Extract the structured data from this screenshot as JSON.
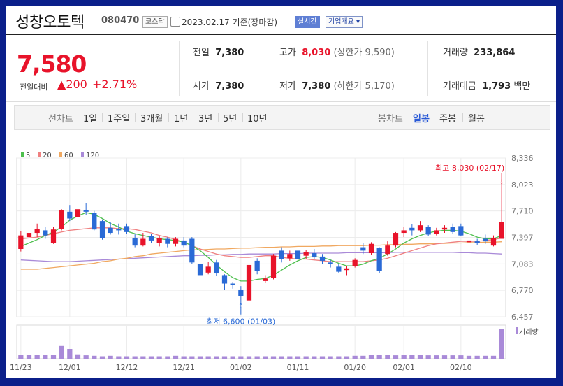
{
  "header": {
    "name": "성창오토텍",
    "code": "080470",
    "market": "코스닥",
    "date": "2023.02.17",
    "basis": "기준(장마감)",
    "realtime": "실시간",
    "company_info": "기업개요"
  },
  "summary": {
    "price": "7,580",
    "change_label": "전일대비",
    "change": "200",
    "change_pct": "+2.71%",
    "prev_label": "전일",
    "prev": "7,380",
    "high_label": "고가",
    "high": "8,030",
    "upper_limit_label": "(상한가",
    "upper_limit": "9,590",
    "upper_close": ")",
    "volume_label": "거래량",
    "volume": "233,864",
    "open_label": "시가",
    "open": "7,380",
    "low_label": "저가",
    "low": "7,380",
    "lower_limit_label": "(하한가",
    "lower_limit": "5,170",
    "lower_close": ")",
    "amount_label": "거래대금",
    "amount": "1,793",
    "amount_unit": "백만"
  },
  "periods": {
    "line_label": "선차트",
    "items": [
      "1일",
      "1주일",
      "3개월",
      "1년",
      "3년",
      "5년",
      "10년"
    ],
    "candle_label": "봉차트",
    "candle_items": [
      "일봉",
      "주봉",
      "월봉"
    ],
    "selected_candle": "일봉"
  },
  "colors": {
    "up": "#e8132a",
    "down": "#2a6ad6",
    "ma5": "#4cbf4c",
    "ma20": "#ef8080",
    "ma60": "#f0a860",
    "ma120": "#a98ad8",
    "volume": "#a98ad8"
  },
  "chart_data": {
    "type": "candlestick",
    "legend": [
      {
        "name": "5",
        "color": "#4cbf4c"
      },
      {
        "name": "20",
        "color": "#ef8080"
      },
      {
        "name": "60",
        "color": "#f0a860"
      },
      {
        "name": "120",
        "color": "#a98ad8"
      }
    ],
    "y_ticks": [
      8336,
      8023,
      7710,
      7397,
      7083,
      6770,
      6457
    ],
    "y_tick_labels": [
      "8,336",
      "8,023",
      "7,710",
      "7,397",
      "7,083",
      "6,770",
      "6,457"
    ],
    "ylim": [
      6457,
      8336
    ],
    "x_labels": [
      {
        "label": "11/23",
        "index": 0
      },
      {
        "label": "12/01",
        "index": 6
      },
      {
        "label": "12/12",
        "index": 13
      },
      {
        "label": "12/21",
        "index": 20
      },
      {
        "label": "01/02",
        "index": 27
      },
      {
        "label": "01/11",
        "index": 34
      },
      {
        "label": "01/20",
        "index": 41
      },
      {
        "label": "02/01",
        "index": 47
      },
      {
        "label": "02/10",
        "index": 54
      }
    ],
    "candles": [
      {
        "o": 7260,
        "c": 7420,
        "h": 7470,
        "l": 7230
      },
      {
        "o": 7400,
        "c": 7450,
        "h": 7490,
        "l": 7330
      },
      {
        "o": 7450,
        "c": 7500,
        "h": 7560,
        "l": 7400
      },
      {
        "o": 7480,
        "c": 7420,
        "h": 7520,
        "l": 7380
      },
      {
        "o": 7330,
        "c": 7490,
        "h": 7520,
        "l": 7320
      },
      {
        "o": 7500,
        "c": 7720,
        "h": 7730,
        "l": 7480
      },
      {
        "o": 7700,
        "c": 7620,
        "h": 7780,
        "l": 7590
      },
      {
        "o": 7640,
        "c": 7730,
        "h": 7800,
        "l": 7620
      },
      {
        "o": 7720,
        "c": 7700,
        "h": 7800,
        "l": 7660
      },
      {
        "o": 7690,
        "c": 7490,
        "h": 7710,
        "l": 7480
      },
      {
        "o": 7590,
        "c": 7390,
        "h": 7610,
        "l": 7370
      },
      {
        "o": 7510,
        "c": 7450,
        "h": 7580,
        "l": 7430
      },
      {
        "o": 7500,
        "c": 7480,
        "h": 7560,
        "l": 7430
      },
      {
        "o": 7530,
        "c": 7460,
        "h": 7560,
        "l": 7440
      },
      {
        "o": 7390,
        "c": 7300,
        "h": 7440,
        "l": 7280
      },
      {
        "o": 7300,
        "c": 7380,
        "h": 7450,
        "l": 7290
      },
      {
        "o": 7410,
        "c": 7360,
        "h": 7440,
        "l": 7330
      },
      {
        "o": 7330,
        "c": 7390,
        "h": 7420,
        "l": 7290
      },
      {
        "o": 7380,
        "c": 7320,
        "h": 7400,
        "l": 7280
      },
      {
        "o": 7320,
        "c": 7380,
        "h": 7400,
        "l": 7290
      },
      {
        "o": 7360,
        "c": 7300,
        "h": 7400,
        "l": 7280
      },
      {
        "o": 7380,
        "c": 7100,
        "h": 7400,
        "l": 7080
      },
      {
        "o": 7080,
        "c": 6950,
        "h": 7100,
        "l": 6920
      },
      {
        "o": 6980,
        "c": 7050,
        "h": 7110,
        "l": 6960
      },
      {
        "o": 7100,
        "c": 6970,
        "h": 7130,
        "l": 6940
      },
      {
        "o": 6950,
        "c": 6850,
        "h": 6960,
        "l": 6780
      },
      {
        "o": 6850,
        "c": 6830,
        "h": 6870,
        "l": 6790
      },
      {
        "o": 6780,
        "c": 6700,
        "h": 6820,
        "l": 6600
      },
      {
        "o": 6650,
        "c": 7070,
        "h": 7080,
        "l": 6640
      },
      {
        "o": 7120,
        "c": 7000,
        "h": 7150,
        "l": 6960
      },
      {
        "o": 6880,
        "c": 6910,
        "h": 6950,
        "l": 6860
      },
      {
        "o": 6920,
        "c": 7180,
        "h": 7200,
        "l": 6900
      },
      {
        "o": 7240,
        "c": 7140,
        "h": 7280,
        "l": 7100
      },
      {
        "o": 7150,
        "c": 7200,
        "h": 7240,
        "l": 7120
      },
      {
        "o": 7240,
        "c": 7140,
        "h": 7270,
        "l": 7120
      },
      {
        "o": 7180,
        "c": 7220,
        "h": 7250,
        "l": 7140
      },
      {
        "o": 7210,
        "c": 7160,
        "h": 7260,
        "l": 7140
      },
      {
        "o": 7170,
        "c": 7120,
        "h": 7200,
        "l": 7080
      },
      {
        "o": 7100,
        "c": 7080,
        "h": 7130,
        "l": 7040
      },
      {
        "o": 7050,
        "c": 6990,
        "h": 7080,
        "l": 6980
      },
      {
        "o": 7010,
        "c": 7030,
        "h": 7060,
        "l": 6950
      },
      {
        "o": 7060,
        "c": 7130,
        "h": 7150,
        "l": 7040
      },
      {
        "o": 7280,
        "c": 7240,
        "h": 7330,
        "l": 7200
      },
      {
        "o": 7210,
        "c": 7320,
        "h": 7340,
        "l": 7190
      },
      {
        "o": 7270,
        "c": 7000,
        "h": 7280,
        "l": 6970
      },
      {
        "o": 7200,
        "c": 7300,
        "h": 7350,
        "l": 7180
      },
      {
        "o": 7300,
        "c": 7450,
        "h": 7460,
        "l": 7280
      },
      {
        "o": 7450,
        "c": 7480,
        "h": 7520,
        "l": 7400
      },
      {
        "o": 7510,
        "c": 7480,
        "h": 7550,
        "l": 7420
      },
      {
        "o": 7480,
        "c": 7540,
        "h": 7590,
        "l": 7460
      },
      {
        "o": 7520,
        "c": 7430,
        "h": 7540,
        "l": 7410
      },
      {
        "o": 7440,
        "c": 7480,
        "h": 7510,
        "l": 7420
      },
      {
        "o": 7490,
        "c": 7510,
        "h": 7540,
        "l": 7450
      },
      {
        "o": 7520,
        "c": 7460,
        "h": 7560,
        "l": 7440
      },
      {
        "o": 7530,
        "c": 7420,
        "h": 7560,
        "l": 7410
      },
      {
        "o": 7340,
        "c": 7360,
        "h": 7380,
        "l": 7310
      },
      {
        "o": 7350,
        "c": 7330,
        "h": 7380,
        "l": 7310
      },
      {
        "o": 7380,
        "c": 7350,
        "h": 7430,
        "l": 7320
      },
      {
        "o": 7300,
        "c": 7390,
        "h": 7420,
        "l": 7290
      },
      {
        "o": 7380,
        "c": 7580,
        "h": 8030,
        "l": 7380
      }
    ],
    "ma5": [
      7290,
      7330,
      7370,
      7420,
      7460,
      7520,
      7600,
      7650,
      7690,
      7670,
      7620,
      7560,
      7520,
      7470,
      7440,
      7420,
      7400,
      7380,
      7370,
      7360,
      7340,
      7300,
      7240,
      7160,
      7070,
      6990,
      6920,
      6880,
      6880,
      6900,
      6910,
      6950,
      7010,
      7070,
      7120,
      7160,
      7170,
      7160,
      7130,
      7090,
      7060,
      7060,
      7080,
      7120,
      7150,
      7200,
      7260,
      7330,
      7380,
      7420,
      7450,
      7470,
      7480,
      7480,
      7470,
      7440,
      7400,
      7380,
      7380,
      7420
    ],
    "ma20": [
      7380,
      7390,
      7400,
      7420,
      7440,
      7460,
      7480,
      7490,
      7500,
      7510,
      7510,
      7510,
      7500,
      7500,
      7490,
      7470,
      7450,
      7420,
      7400,
      7370,
      7340,
      7300,
      7260,
      7230,
      7200,
      7180,
      7170,
      7160,
      7160,
      7170,
      7180,
      7180,
      7160,
      7150,
      7140,
      7140,
      7130,
      7120,
      7110,
      7110,
      7110,
      7110,
      7110,
      7120,
      7130,
      7150,
      7180,
      7210,
      7240,
      7270,
      7300,
      7320,
      7330,
      7340,
      7350,
      7350,
      7350,
      7360,
      7370,
      7390
    ],
    "ma60": [
      7020,
      7020,
      7020,
      7030,
      7040,
      7050,
      7060,
      7070,
      7080,
      7090,
      7110,
      7120,
      7140,
      7150,
      7170,
      7180,
      7200,
      7210,
      7220,
      7230,
      7240,
      7250,
      7250,
      7255,
      7260,
      7260,
      7265,
      7270,
      7270,
      7275,
      7280,
      7280,
      7285,
      7285,
      7290,
      7290,
      7290,
      7295,
      7295,
      7300,
      7300,
      7300,
      7300,
      7305,
      7305,
      7310,
      7310,
      7315,
      7315,
      7320,
      7320,
      7325,
      7325,
      7330,
      7330,
      7335,
      7335,
      7340,
      7340,
      7345
    ],
    "ma120": [
      7130,
      7125,
      7120,
      7115,
      7110,
      7110,
      7110,
      7115,
      7120,
      7125,
      7130,
      7135,
      7140,
      7145,
      7150,
      7155,
      7160,
      7165,
      7170,
      7175,
      7180,
      7180,
      7185,
      7185,
      7190,
      7190,
      7195,
      7195,
      7200,
      7200,
      7200,
      7200,
      7205,
      7205,
      7205,
      7210,
      7210,
      7210,
      7210,
      7210,
      7215,
      7215,
      7215,
      7215,
      7215,
      7215,
      7220,
      7220,
      7220,
      7220,
      7220,
      7220,
      7220,
      7220,
      7215,
      7215,
      7210,
      7210,
      7205,
      7200
    ],
    "volume": [
      8,
      8,
      8,
      8,
      8,
      26,
      20,
      9,
      7,
      6,
      5,
      6,
      5,
      5,
      5,
      5,
      5,
      5,
      5,
      6,
      5,
      5,
      5,
      5,
      5,
      5,
      5,
      5,
      5,
      5,
      5,
      5,
      5,
      5,
      5,
      5,
      5,
      5,
      5,
      5,
      5,
      6,
      6,
      8,
      8,
      8,
      7,
      8,
      8,
      8,
      7,
      7,
      7,
      7,
      7,
      6,
      6,
      6,
      6,
      60
    ],
    "high_annotation": {
      "label": "최고",
      "value": "8,030",
      "date": "(02/17)"
    },
    "low_annotation": {
      "label": "최저",
      "value": "6,600",
      "date": "(01/03)"
    },
    "volume_label": "거래량"
  }
}
